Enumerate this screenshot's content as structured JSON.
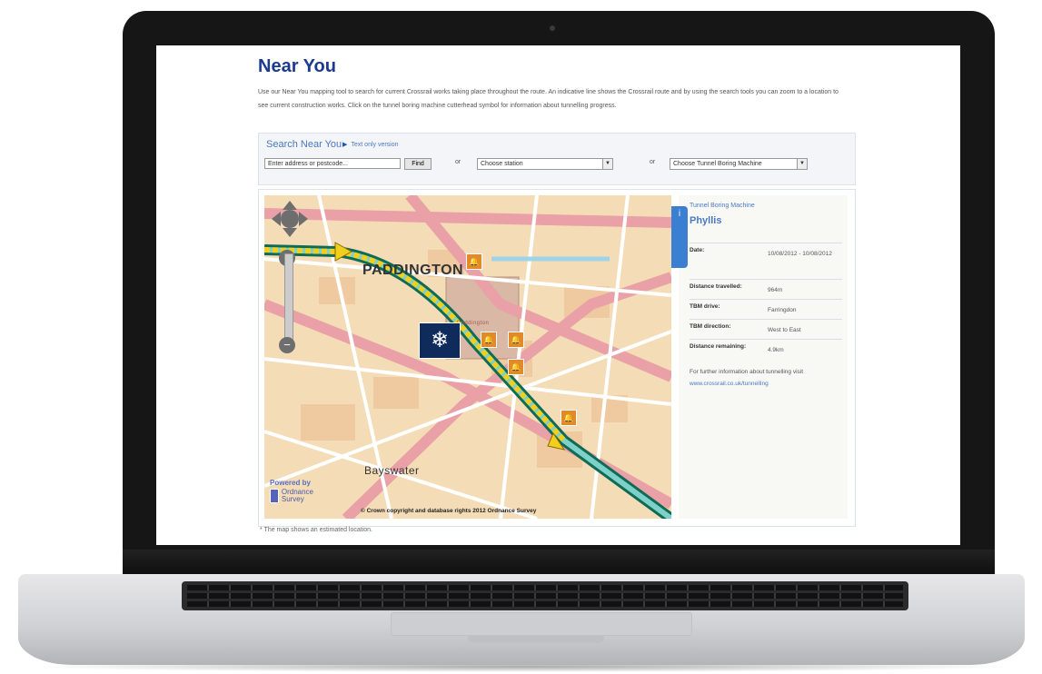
{
  "page": {
    "title": "Near You",
    "intro": "Use our Near You mapping tool to search for current Crossrail works taking place throughout the route. An indicative line shows the Crossrail route and by using the search tools you can zoom to a location to see current construction works. Click on the tunnel boring machine cutterhead symbol for information about tunnelling progress."
  },
  "search": {
    "title": "Search Near You",
    "text_only_link": "Text only version",
    "address_placeholder": "Enter address or postcode...",
    "find_label": "Find",
    "or_label": "or",
    "station_select": "Choose station",
    "tbm_select": "Choose Tunnel Boring Machine"
  },
  "map": {
    "labels": {
      "paddington": "PADDINGTON",
      "bayswater": "Bayswater",
      "paddington_station": "Paddington"
    },
    "powered_by": "Powered by",
    "os_logo_line1": "Ordnance",
    "os_logo_line2": "Survey",
    "copyright": "© Crown copyright and database rights 2012 Ordnance Survey",
    "tbm_icon": "tunnel-boring-machine-icon",
    "pin_icon": "bell-icon"
  },
  "info_panel": {
    "tab_icon": "i",
    "subtitle": "Tunnel Boring Machine",
    "name": "Phyllis",
    "rows": [
      {
        "key": "Date:",
        "value": "10/08/2012 - 10/08/2012"
      },
      {
        "key": "Distance travelled:",
        "value": "964m"
      },
      {
        "key": "TBM drive:",
        "value": "Farringdon"
      },
      {
        "key": "TBM direction:",
        "value": "West to East"
      },
      {
        "key": "Distance remaining:",
        "value": "4.9km"
      }
    ],
    "more_text": "For further information about tunnelling visit",
    "more_link": "www.crossrail.co.uk/tunnelling"
  },
  "footnote": "* The map shows an estimated location."
}
